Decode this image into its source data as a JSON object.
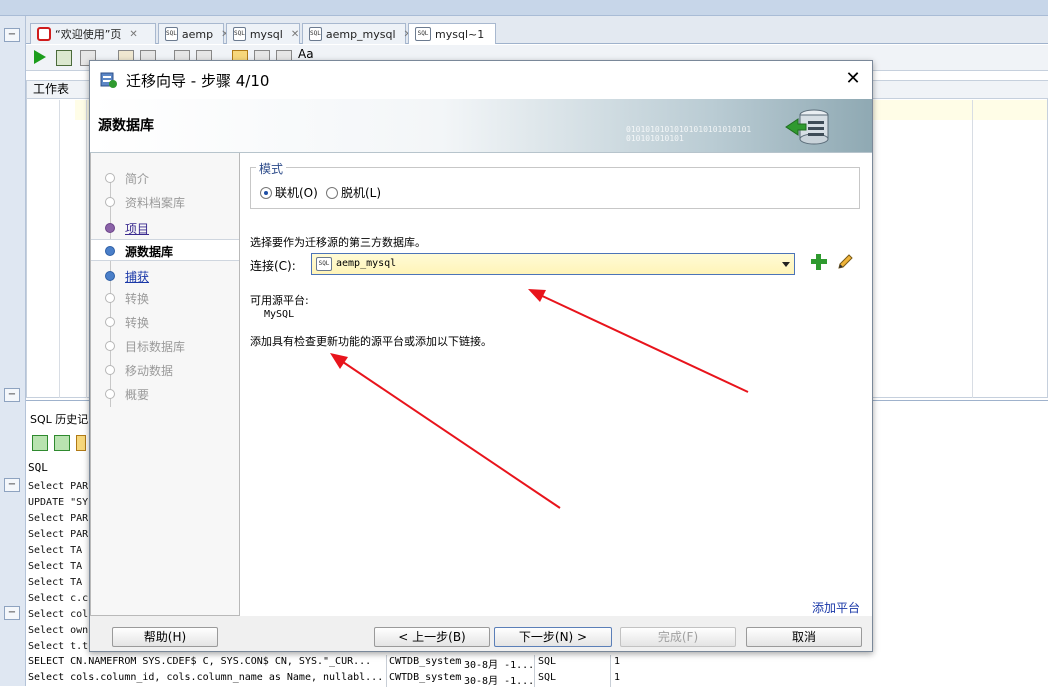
{
  "ide": {
    "tabs": [
      {
        "label": "“欢迎使用”页",
        "icon": "oracle-icon"
      },
      {
        "label": "aemp",
        "icon": "sql-file-icon"
      },
      {
        "label": "mysql",
        "icon": "sql-file-icon"
      },
      {
        "label": "aemp_mysql",
        "icon": "sql-file-icon"
      },
      {
        "label": "mysql~1",
        "icon": "sql-file-icon"
      }
    ],
    "toolbar_font_label": "Aa",
    "worksheet_label": "工作表",
    "history_title": "SQL 历史记",
    "history_col_sql": "SQL",
    "history_lines": [
      "Select PAR",
      "UPDATE \"SY",
      "Select PAR",
      "Select PAR",
      "Select  TA",
      "Select  TA",
      "Select  TA",
      "Select c.c",
      "Select col",
      "Select own",
      "Select t.t"
    ],
    "history_rows": [
      {
        "sql": "SELECT CN.NAMEFROM   SYS.CDEF$ C, SYS.CON$ CN, SYS.\"_CUR...",
        "conn": "CWTDB_system",
        "date": "30-8月 -1...",
        "type": "SQL",
        "n": "1"
      },
      {
        "sql": "Select cols.column_id, cols.column_name as Name, nullabl...",
        "conn": "CWTDB_system",
        "date": "30-8月 -1...",
        "type": "SQL",
        "n": "1"
      }
    ]
  },
  "dialog": {
    "title": "迁移向导 - 步骤 4/10",
    "banner_title": "源数据库",
    "banner_bits": "01010101010101010101010101\n010101010101",
    "steps": [
      {
        "label": "简介",
        "state": "done"
      },
      {
        "label": "资料档案库",
        "state": "done"
      },
      {
        "label": "项目",
        "state": "visited"
      },
      {
        "label": "源数据库",
        "state": "current"
      },
      {
        "label": "捕获",
        "state": "next"
      },
      {
        "label": "转换",
        "state": "pending"
      },
      {
        "label": "转换",
        "state": "pending"
      },
      {
        "label": "目标数据库",
        "state": "pending"
      },
      {
        "label": "移动数据",
        "state": "pending"
      },
      {
        "label": "概要",
        "state": "pending"
      }
    ],
    "mode_legend": "模式",
    "mode_online": "联机(O)",
    "mode_offline": "脱机(L)",
    "mode_selected": "online",
    "instruction": "选择要作为迁移源的第三方数据库。",
    "connection_label": "连接(C):",
    "connection_value": "aemp_mysql",
    "available_platform_label": "可用源平台:",
    "available_platform_value": "MySQL",
    "add_platform_hint": "添加具有检查更新功能的源平台或添加以下链接。",
    "add_platform_link": "添加平台",
    "buttons": {
      "help": "帮助(H)",
      "back": "< 上一步(B)",
      "next": "下一步(N) >",
      "finish": "完成(F)",
      "cancel": "取消"
    }
  },
  "colors": {
    "annotation_arrow": "#e8141c",
    "link": "#1a38a8",
    "combo_border": "#4c74b8"
  }
}
